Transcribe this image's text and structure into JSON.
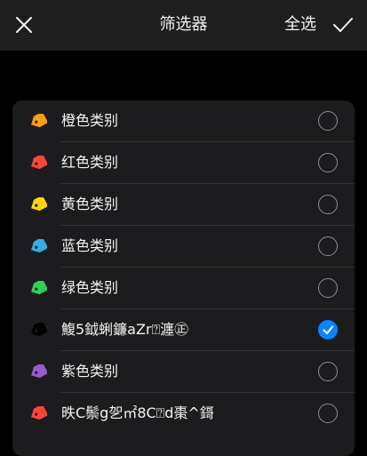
{
  "header": {
    "title": "筛选器",
    "select_all_label": "全选"
  },
  "filters": [
    {
      "label": "橙色类别",
      "color": "#ff9f0a",
      "checked": false
    },
    {
      "label": "红色类别",
      "color": "#ff453a",
      "checked": false
    },
    {
      "label": "黄色类别",
      "color": "#ffd60a",
      "checked": false
    },
    {
      "label": "蓝色类别",
      "color": "#32ade6",
      "checked": false
    },
    {
      "label": "绿色类别",
      "color": "#30d158",
      "checked": false
    },
    {
      "label": "鰒5鉞蜊鐮aZr⍰瀍㊣",
      "color": "#000000",
      "checked": true
    },
    {
      "label": "紫色类别",
      "color": "#9b59d0",
      "checked": false
    },
    {
      "label": "昳C鬃g乫㎡8C⍰d棗^鎶",
      "color": "#ff453a",
      "checked": false
    }
  ],
  "colors": {
    "accent": "#0a84ff",
    "topbar_bg": "#1e1e1e",
    "list_bg": "#1c1c1e"
  },
  "icons": {
    "close": "close-icon",
    "confirm": "checkmark-icon",
    "tag": "tag-icon"
  }
}
